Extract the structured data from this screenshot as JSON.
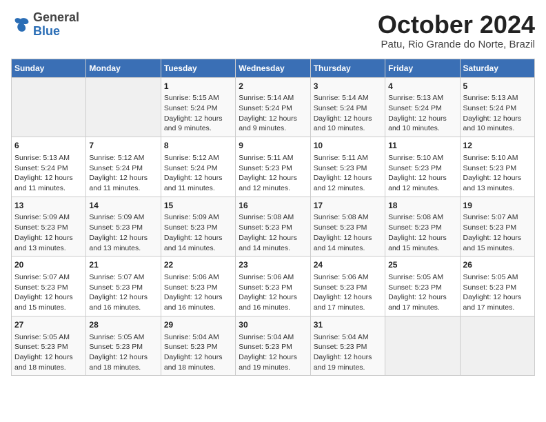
{
  "header": {
    "logo": {
      "general": "General",
      "blue": "Blue"
    },
    "title": "October 2024",
    "subtitle": "Patu, Rio Grande do Norte, Brazil"
  },
  "columns": [
    "Sunday",
    "Monday",
    "Tuesday",
    "Wednesday",
    "Thursday",
    "Friday",
    "Saturday"
  ],
  "weeks": [
    [
      {
        "day": "",
        "sunrise": "",
        "sunset": "",
        "daylight": "",
        "empty": true
      },
      {
        "day": "",
        "sunrise": "",
        "sunset": "",
        "daylight": "",
        "empty": true
      },
      {
        "day": "1",
        "sunrise": "Sunrise: 5:15 AM",
        "sunset": "Sunset: 5:24 PM",
        "daylight": "Daylight: 12 hours and 9 minutes."
      },
      {
        "day": "2",
        "sunrise": "Sunrise: 5:14 AM",
        "sunset": "Sunset: 5:24 PM",
        "daylight": "Daylight: 12 hours and 9 minutes."
      },
      {
        "day": "3",
        "sunrise": "Sunrise: 5:14 AM",
        "sunset": "Sunset: 5:24 PM",
        "daylight": "Daylight: 12 hours and 10 minutes."
      },
      {
        "day": "4",
        "sunrise": "Sunrise: 5:13 AM",
        "sunset": "Sunset: 5:24 PM",
        "daylight": "Daylight: 12 hours and 10 minutes."
      },
      {
        "day": "5",
        "sunrise": "Sunrise: 5:13 AM",
        "sunset": "Sunset: 5:24 PM",
        "daylight": "Daylight: 12 hours and 10 minutes."
      }
    ],
    [
      {
        "day": "6",
        "sunrise": "Sunrise: 5:13 AM",
        "sunset": "Sunset: 5:24 PM",
        "daylight": "Daylight: 12 hours and 11 minutes."
      },
      {
        "day": "7",
        "sunrise": "Sunrise: 5:12 AM",
        "sunset": "Sunset: 5:24 PM",
        "daylight": "Daylight: 12 hours and 11 minutes."
      },
      {
        "day": "8",
        "sunrise": "Sunrise: 5:12 AM",
        "sunset": "Sunset: 5:24 PM",
        "daylight": "Daylight: 12 hours and 11 minutes."
      },
      {
        "day": "9",
        "sunrise": "Sunrise: 5:11 AM",
        "sunset": "Sunset: 5:23 PM",
        "daylight": "Daylight: 12 hours and 12 minutes."
      },
      {
        "day": "10",
        "sunrise": "Sunrise: 5:11 AM",
        "sunset": "Sunset: 5:23 PM",
        "daylight": "Daylight: 12 hours and 12 minutes."
      },
      {
        "day": "11",
        "sunrise": "Sunrise: 5:10 AM",
        "sunset": "Sunset: 5:23 PM",
        "daylight": "Daylight: 12 hours and 12 minutes."
      },
      {
        "day": "12",
        "sunrise": "Sunrise: 5:10 AM",
        "sunset": "Sunset: 5:23 PM",
        "daylight": "Daylight: 12 hours and 13 minutes."
      }
    ],
    [
      {
        "day": "13",
        "sunrise": "Sunrise: 5:09 AM",
        "sunset": "Sunset: 5:23 PM",
        "daylight": "Daylight: 12 hours and 13 minutes."
      },
      {
        "day": "14",
        "sunrise": "Sunrise: 5:09 AM",
        "sunset": "Sunset: 5:23 PM",
        "daylight": "Daylight: 12 hours and 13 minutes."
      },
      {
        "day": "15",
        "sunrise": "Sunrise: 5:09 AM",
        "sunset": "Sunset: 5:23 PM",
        "daylight": "Daylight: 12 hours and 14 minutes."
      },
      {
        "day": "16",
        "sunrise": "Sunrise: 5:08 AM",
        "sunset": "Sunset: 5:23 PM",
        "daylight": "Daylight: 12 hours and 14 minutes."
      },
      {
        "day": "17",
        "sunrise": "Sunrise: 5:08 AM",
        "sunset": "Sunset: 5:23 PM",
        "daylight": "Daylight: 12 hours and 14 minutes."
      },
      {
        "day": "18",
        "sunrise": "Sunrise: 5:08 AM",
        "sunset": "Sunset: 5:23 PM",
        "daylight": "Daylight: 12 hours and 15 minutes."
      },
      {
        "day": "19",
        "sunrise": "Sunrise: 5:07 AM",
        "sunset": "Sunset: 5:23 PM",
        "daylight": "Daylight: 12 hours and 15 minutes."
      }
    ],
    [
      {
        "day": "20",
        "sunrise": "Sunrise: 5:07 AM",
        "sunset": "Sunset: 5:23 PM",
        "daylight": "Daylight: 12 hours and 15 minutes."
      },
      {
        "day": "21",
        "sunrise": "Sunrise: 5:07 AM",
        "sunset": "Sunset: 5:23 PM",
        "daylight": "Daylight: 12 hours and 16 minutes."
      },
      {
        "day": "22",
        "sunrise": "Sunrise: 5:06 AM",
        "sunset": "Sunset: 5:23 PM",
        "daylight": "Daylight: 12 hours and 16 minutes."
      },
      {
        "day": "23",
        "sunrise": "Sunrise: 5:06 AM",
        "sunset": "Sunset: 5:23 PM",
        "daylight": "Daylight: 12 hours and 16 minutes."
      },
      {
        "day": "24",
        "sunrise": "Sunrise: 5:06 AM",
        "sunset": "Sunset: 5:23 PM",
        "daylight": "Daylight: 12 hours and 17 minutes."
      },
      {
        "day": "25",
        "sunrise": "Sunrise: 5:05 AM",
        "sunset": "Sunset: 5:23 PM",
        "daylight": "Daylight: 12 hours and 17 minutes."
      },
      {
        "day": "26",
        "sunrise": "Sunrise: 5:05 AM",
        "sunset": "Sunset: 5:23 PM",
        "daylight": "Daylight: 12 hours and 17 minutes."
      }
    ],
    [
      {
        "day": "27",
        "sunrise": "Sunrise: 5:05 AM",
        "sunset": "Sunset: 5:23 PM",
        "daylight": "Daylight: 12 hours and 18 minutes."
      },
      {
        "day": "28",
        "sunrise": "Sunrise: 5:05 AM",
        "sunset": "Sunset: 5:23 PM",
        "daylight": "Daylight: 12 hours and 18 minutes."
      },
      {
        "day": "29",
        "sunrise": "Sunrise: 5:04 AM",
        "sunset": "Sunset: 5:23 PM",
        "daylight": "Daylight: 12 hours and 18 minutes."
      },
      {
        "day": "30",
        "sunrise": "Sunrise: 5:04 AM",
        "sunset": "Sunset: 5:23 PM",
        "daylight": "Daylight: 12 hours and 19 minutes."
      },
      {
        "day": "31",
        "sunrise": "Sunrise: 5:04 AM",
        "sunset": "Sunset: 5:23 PM",
        "daylight": "Daylight: 12 hours and 19 minutes."
      },
      {
        "day": "",
        "sunrise": "",
        "sunset": "",
        "daylight": "",
        "empty": true
      },
      {
        "day": "",
        "sunrise": "",
        "sunset": "",
        "daylight": "",
        "empty": true
      }
    ]
  ]
}
